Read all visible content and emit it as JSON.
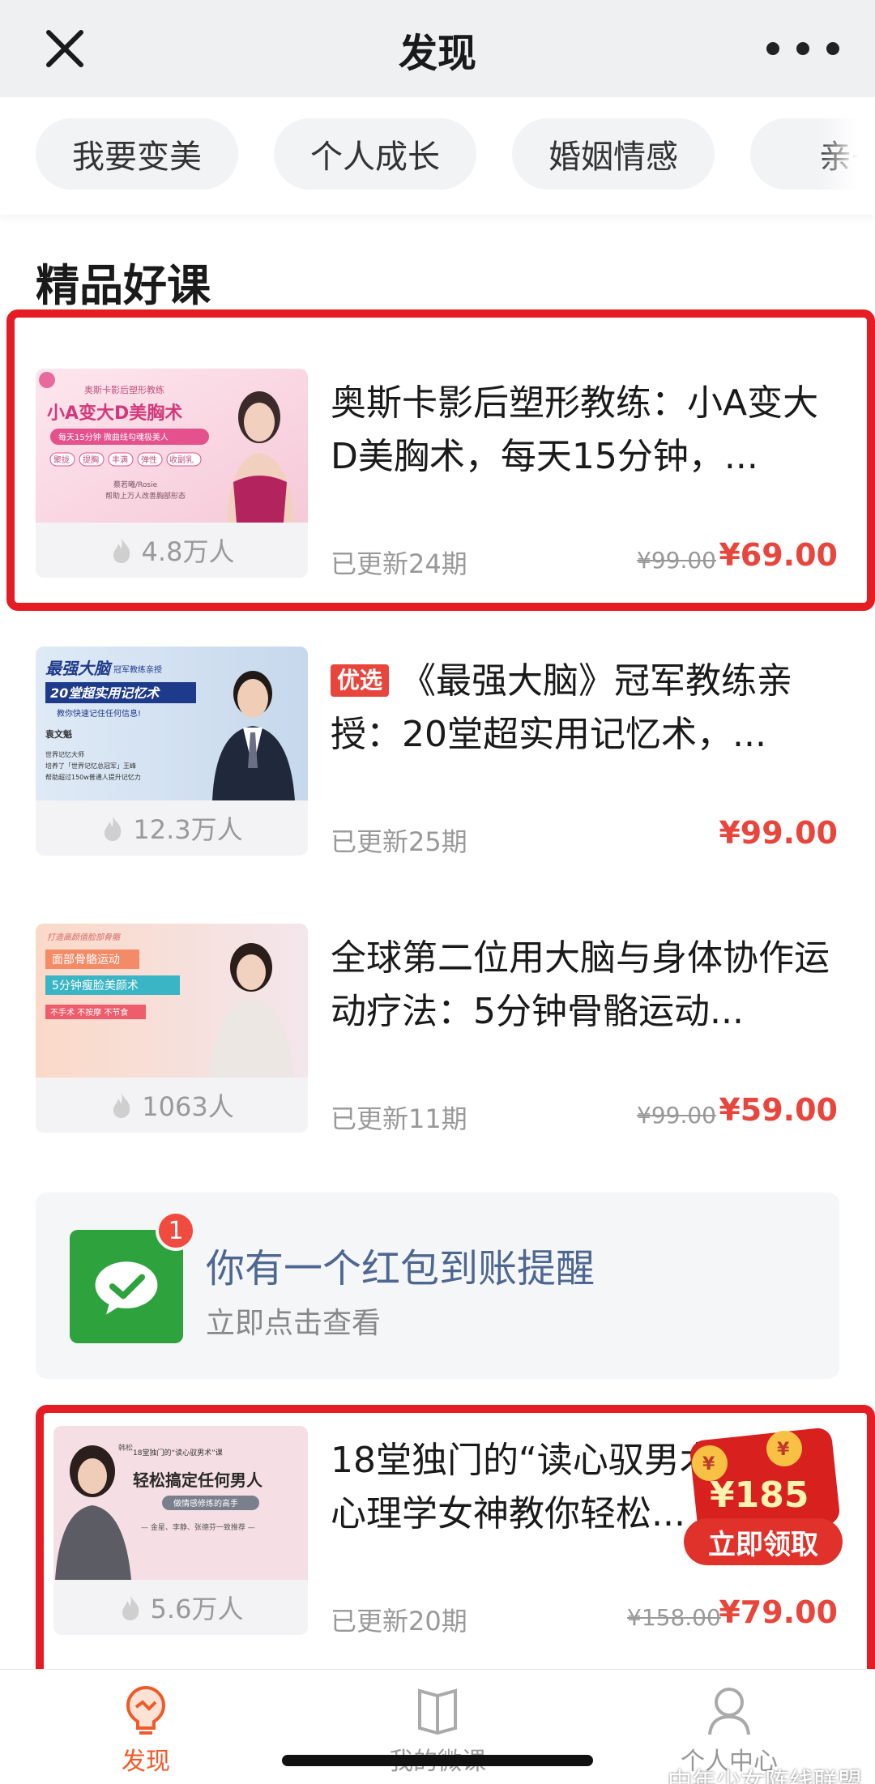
{
  "header": {
    "title": "发现"
  },
  "tabs": [
    "我要变美",
    "个人成长",
    "婚姻情感",
    "亲子"
  ],
  "section_title": "精品好课",
  "courses": [
    {
      "title": "奥斯卡影后塑形教练：小A变大D美胸术，每天15分钟，...",
      "badge": "",
      "learners": "4.8万人",
      "updated": "已更新24期",
      "original_price": "¥99.00",
      "price": "¥69.00",
      "thumb": {
        "line1": "奥斯卡影后塑形教练",
        "line2": "小A变大D美胸术",
        "line3": "每天15分钟 微曲线勾魂极美人",
        "tags": [
          "聚拢",
          "提胸",
          "丰满",
          "弹性",
          "收副乳"
        ],
        "name": "蔡若曦/Rosie",
        "note": "帮助上万人改善胸部形态"
      }
    },
    {
      "title": "《最强大脑》冠军教练亲授：20堂超实用记忆术，...",
      "badge": "优选",
      "learners": "12.3万人",
      "updated": "已更新25期",
      "original_price": "",
      "price": "¥99.00",
      "thumb": {
        "line1": "最强大脑",
        "line0": "冠军教练亲授",
        "line2": "20堂超实用记忆术",
        "line3": "教你快速记住任何信息!",
        "name": "袁文魁",
        "note1": "世界记忆大师",
        "note2": "培养了「世界记忆总冠军」王峰",
        "note3": "帮助超过150w普通人提升记忆力"
      }
    },
    {
      "title": "全球第二位用大脑与身体协作运动疗法：5分钟骨骼运动...",
      "badge": "",
      "learners": "1063人",
      "updated": "已更新11期",
      "original_price": "¥99.00",
      "price": "¥59.00",
      "thumb": {
        "line0": "打造高颜值脸部骨骼",
        "line1": "面部骨骼运动",
        "line2": "5分钟瘦脸美颜术",
        "line3": "不手术 不按摩 不节食"
      }
    },
    {
      "title": "18堂独门的“读心驭男术”，大心理学女神教你轻松...",
      "badge": "",
      "learners": "5.6万人",
      "updated": "已更新20期",
      "original_price": "¥158.00",
      "price": "¥79.00",
      "thumb": {
        "line0": "18堂独门的“读心驭男术”课",
        "line1": "轻松搞定任何男人",
        "line2": "做情感修炼的高手",
        "line3": "— 金星、李静、张德芬一致推荐 —",
        "name": "韩松"
      }
    }
  ],
  "notice": {
    "badge": "1",
    "title": "你有一个红包到账提醒",
    "subtitle": "立即点击查看"
  },
  "red_packet": {
    "amount": "¥185",
    "action": "立即领取"
  },
  "bottom_nav": [
    {
      "label": "发现",
      "icon": "discover-icon",
      "active": true
    },
    {
      "label": "我的微课",
      "icon": "book-icon",
      "active": false
    },
    {
      "label": "个人中心",
      "icon": "person-icon",
      "active": false
    }
  ],
  "watermark": "中年少女阵线联盟",
  "colors": {
    "accent": "#e8453c",
    "highlight": "#e51c23",
    "wechat": "#2ea33d",
    "nav_active": "#f05a28"
  }
}
